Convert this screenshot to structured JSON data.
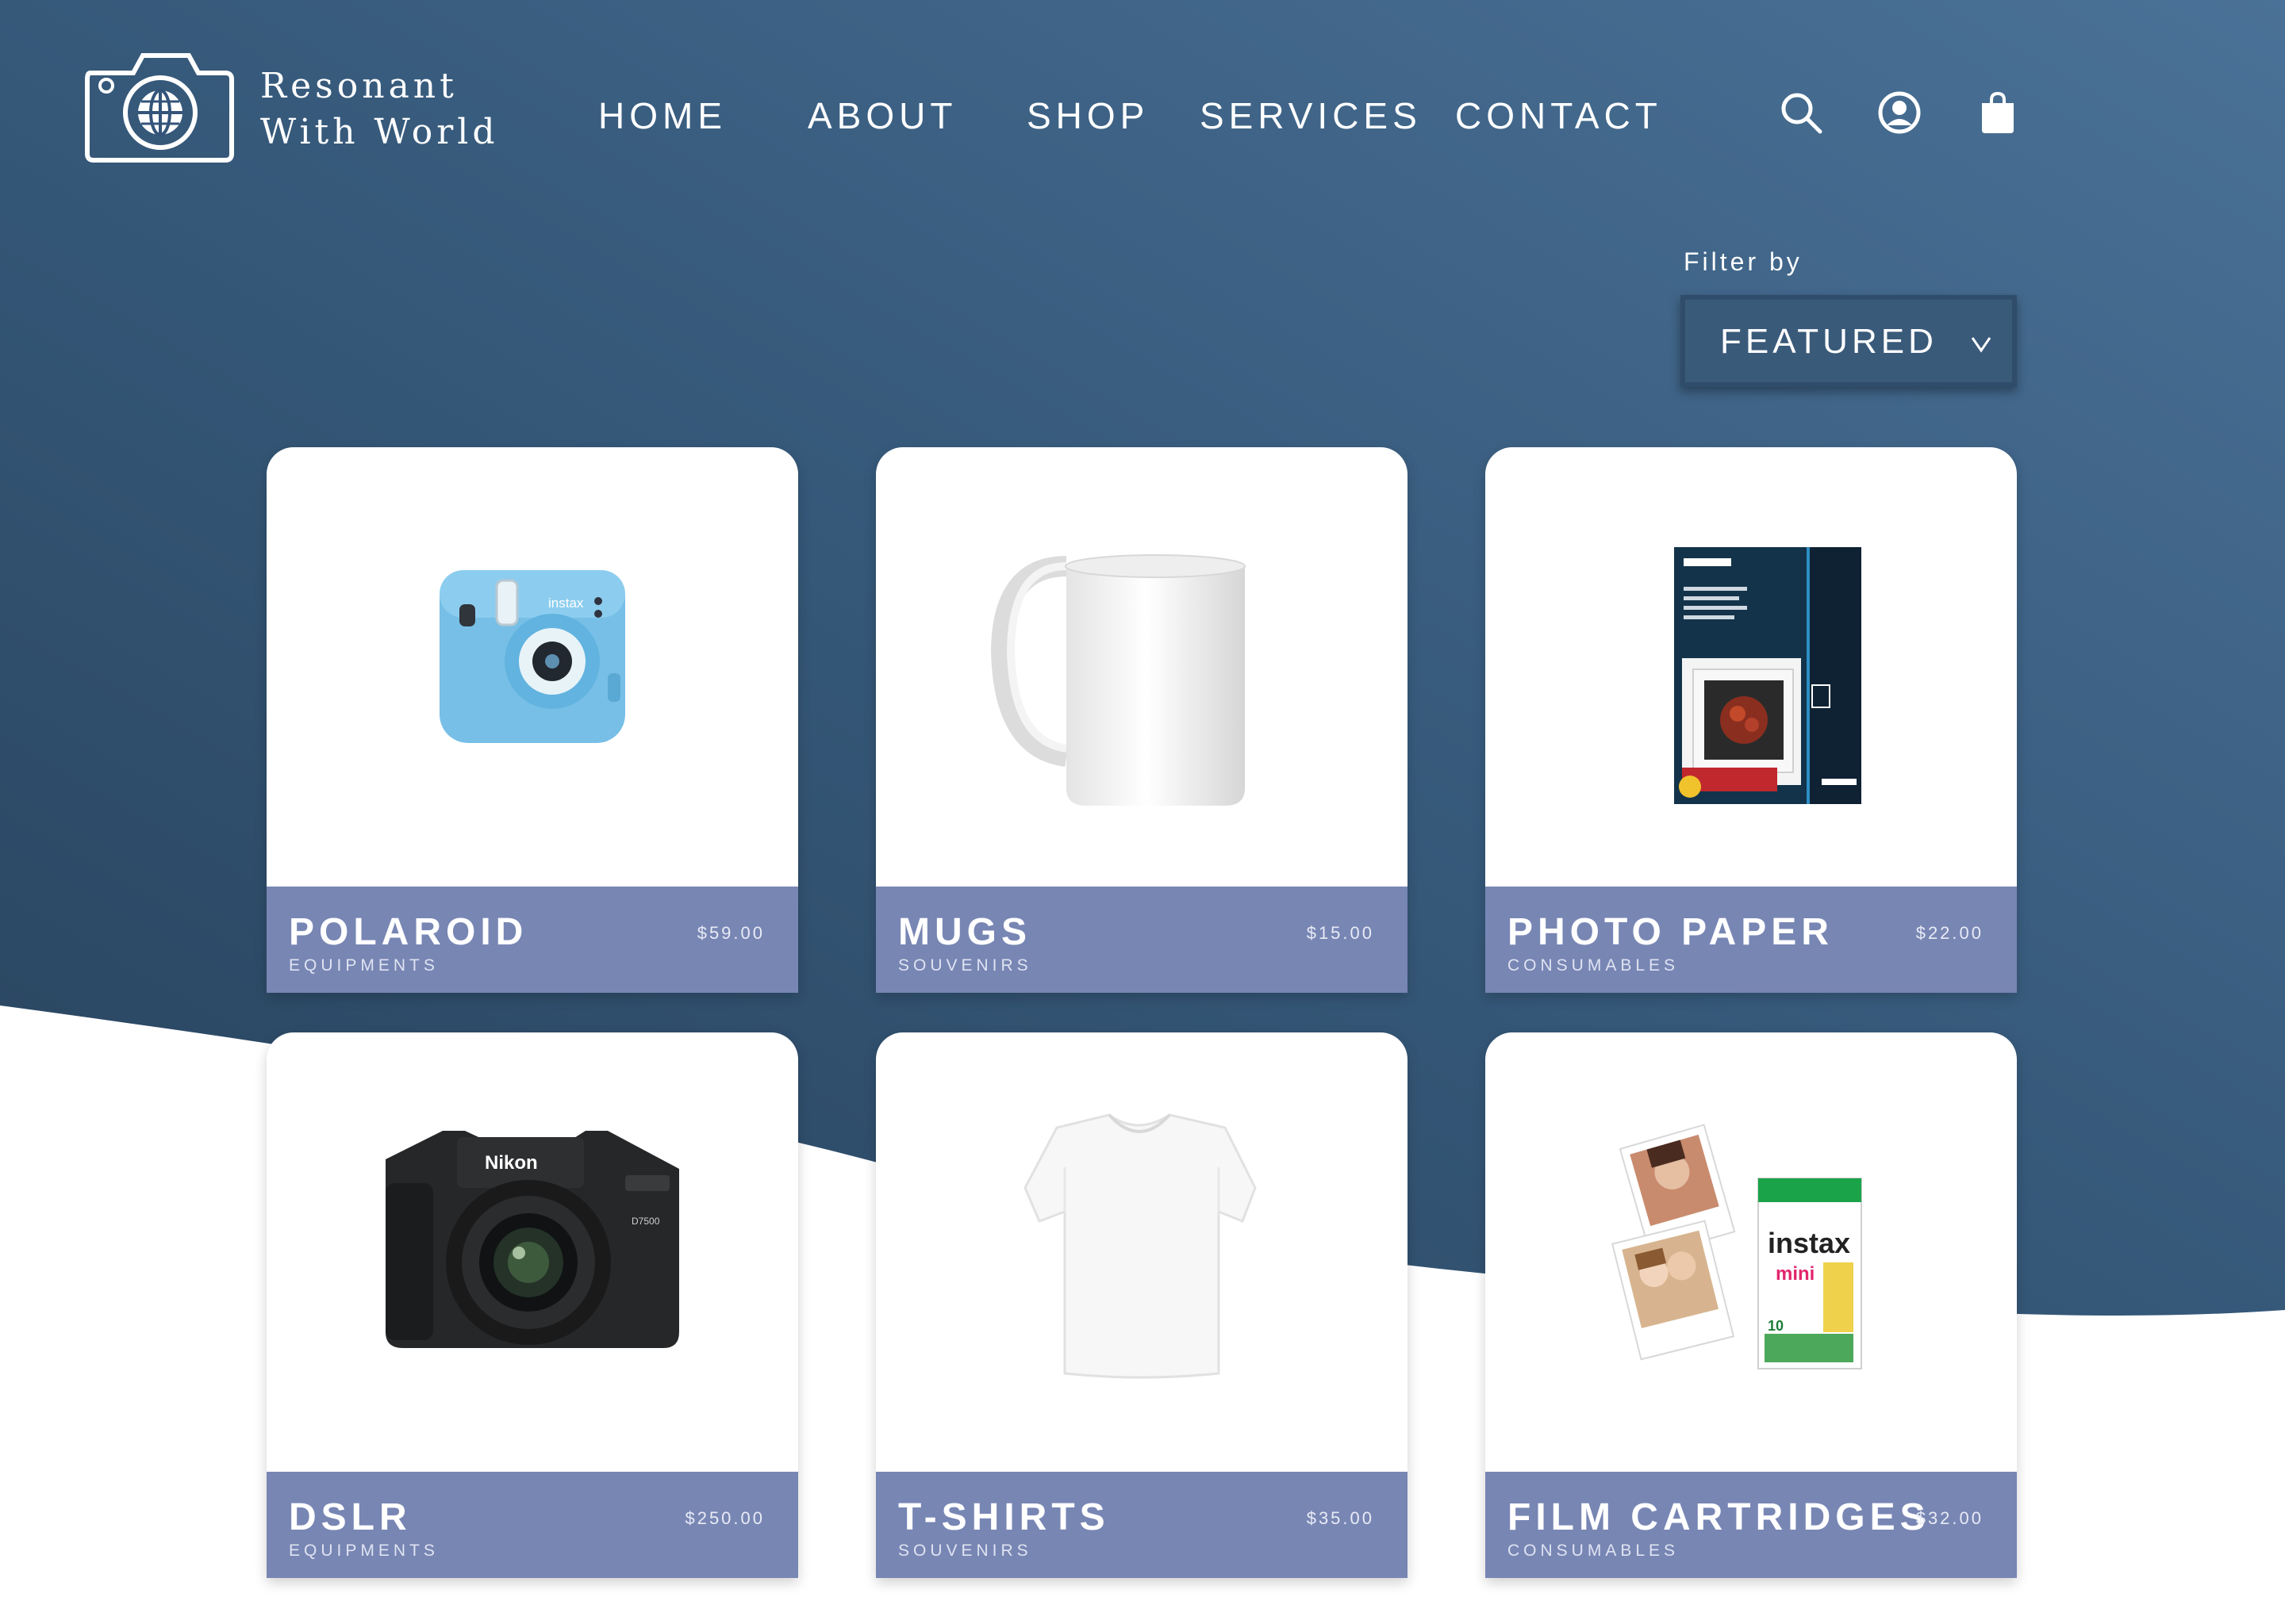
{
  "brand": {
    "line1": "Resonant",
    "line2": "With World",
    "logo_icon": "camera-globe-icon"
  },
  "nav": {
    "items": [
      {
        "label": "HOME"
      },
      {
        "label": "ABOUT"
      },
      {
        "label": "SHOP"
      },
      {
        "label": "SERVICES"
      },
      {
        "label": "CONTACT"
      }
    ]
  },
  "header_icons": [
    "search-icon",
    "account-icon",
    "shopping-bag-icon"
  ],
  "filter": {
    "label": "Filter by",
    "selected": "FEATURED",
    "icon": "chevron-down-icon"
  },
  "products": [
    {
      "name": "POLAROID",
      "category": "EQUIPMENTS",
      "price": "$59.00",
      "image": "instant-camera"
    },
    {
      "name": "MUGS",
      "category": "SOUVENIRS",
      "price": "$15.00",
      "image": "white-mug"
    },
    {
      "name": "PHOTO PAPER",
      "category": "CONSUMABLES",
      "price": "$22.00",
      "image": "photo-paper-pack"
    },
    {
      "name": "DSLR",
      "category": "EQUIPMENTS",
      "price": "$250.00",
      "image": "dslr-camera"
    },
    {
      "name": "T-SHIRTS",
      "category": "SOUVENIRS",
      "price": "$35.00",
      "image": "white-tshirt"
    },
    {
      "name": "FILM CARTRIDGES",
      "category": "CONSUMABLES",
      "price": "$32.00",
      "image": "instant-film-pack"
    }
  ],
  "colors": {
    "background_dark": "#2b4863",
    "background_light": "#4b7196",
    "card_footer": "#7886b4",
    "page": "#ffffff"
  }
}
